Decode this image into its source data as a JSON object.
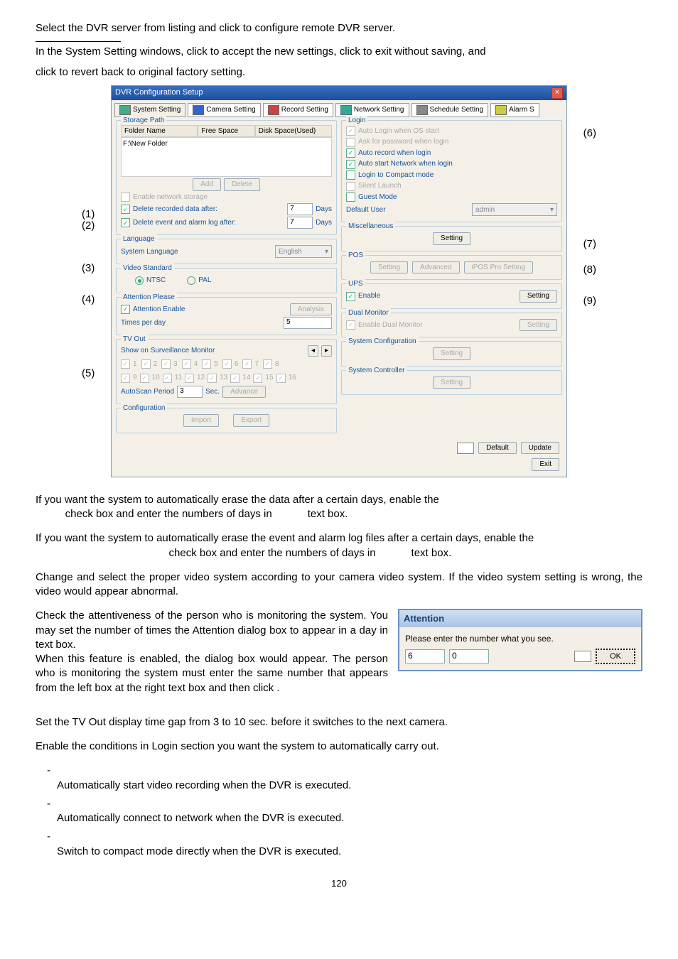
{
  "intro1": "Select the DVR server from listing and click               to configure remote DVR server.",
  "intro2a": "In the System Setting windows, click                 to accept the new settings, click              to exit without saving, and",
  "intro2b": "click              to revert back to original factory setting.",
  "dialog": {
    "title": "DVR Configuration Setup",
    "tabs": [
      "System Setting",
      "Camera Setting",
      "Record Setting",
      "Network Setting",
      "Schedule Setting",
      "Alarm S"
    ],
    "storage": {
      "legend": "Storage Path",
      "cols": [
        "Folder Name",
        "Free Space",
        "Disk Space(Used)"
      ],
      "row": "F:\\New Folder",
      "add": "Add",
      "del": "Delete",
      "net": "Enable network storage",
      "d1": "Delete recorded data after:",
      "d1v": "7",
      "days": "Days",
      "d2": "Delete event and alarm log after:",
      "d2v": "7"
    },
    "lang": {
      "legend": "Language",
      "lbl": "System Language",
      "val": "English"
    },
    "vid": {
      "legend": "Video Standard",
      "ntsc": "NTSC",
      "pal": "PAL"
    },
    "att": {
      "legend": "Attention Please",
      "en": "Attention Enable",
      "an": "Analysis",
      "tpd": "Times per day",
      "tv": "5"
    },
    "tv": {
      "legend": "TV Out",
      "show": "Show on Surveillance Monitor",
      "auto": "AutoScan Period",
      "av": "3",
      "sec": "Sec.",
      "adv": "Advance"
    },
    "cfg": {
      "legend": "Configuration",
      "imp": "Import",
      "exp": "Export"
    },
    "login": {
      "legend": "Login",
      "a": "Auto Login when OS start",
      "b": "Ask for password when login",
      "c": "Auto record when login",
      "d": "Auto start Network when login",
      "e": "Login to Compact mode",
      "f": "Silent Launch",
      "g": "Guest Mode",
      "du": "Default User",
      "dv": "admin"
    },
    "misc": {
      "legend": "Miscellaneous",
      "s": "Setting"
    },
    "pos": {
      "legend": "POS",
      "s": "Setting",
      "a": "Advanced",
      "i": "iPOS Pro Setting"
    },
    "ups": {
      "legend": "UPS",
      "e": "Enable",
      "s": "Setting"
    },
    "dual": {
      "legend": "Dual Monitor",
      "e": "Enable Dual Monitor",
      "s": "Setting"
    },
    "syscfg": {
      "legend": "System Configuration",
      "s": "Setting"
    },
    "sysctl": {
      "legend": "System Controller",
      "s": "Setting"
    },
    "footer": {
      "def": "Default",
      "upd": "Update",
      "exit": "Exit"
    }
  },
  "callouts": {
    "c1": "(1)",
    "c2": "(2)",
    "c3": "(3)",
    "c4": "(4)",
    "c5": "(5)",
    "c6": "(6)",
    "c7": "(7)",
    "c8": "(8)",
    "c9": "(9)"
  },
  "p1a": "If you want the system to automatically erase the data after a certain days, enable the",
  "p1b": "          check box and enter the numbers of days in            text box.",
  "p2a": "If you want the system to automatically erase the event and alarm log files after a certain days, enable the",
  "p2b": "                                             check box and enter the numbers of days in            text box.",
  "p3": "Change and select the proper video system according to your camera video system. If the video system setting is wrong, the video would appear abnormal.",
  "p4a": "Check the attentiveness of the person who is monitoring the system. You may set the number of times the Attention dialog box to appear in a day in                             text box.",
  "p4b": "When this feature is enabled, the                    dialog box would appear. The person who is monitoring the system must enter the same number that appears from the left box at the right text box and then click        .",
  "attbox": {
    "title": "Attention",
    "msg": "Please enter the number what you see.",
    "l": "6",
    "r": "0",
    "ok": "OK"
  },
  "p5": "Set the TV Out display time gap from 3 to 10 sec. before it switches to the next camera.",
  "p6": "Enable the conditions in Login section you want the system to automatically carry out.",
  "li1": "Automatically start video recording when the DVR is executed.",
  "li2": "Automatically connect to network when the DVR is executed.",
  "li3": "Switch to compact mode directly when the DVR is executed.",
  "page": "120"
}
